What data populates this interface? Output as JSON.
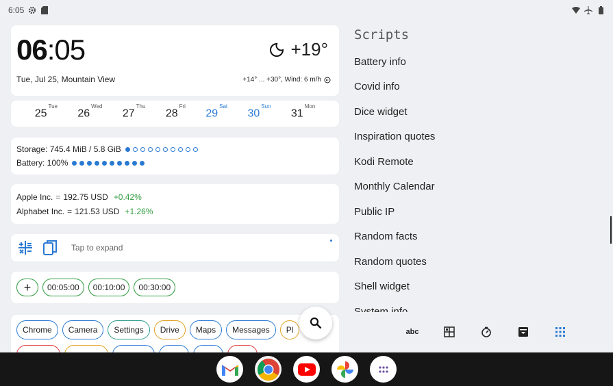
{
  "status_bar": {
    "time": "6:05"
  },
  "clock": {
    "hours": "06",
    "separator": ":",
    "minutes": "05",
    "date": "Tue, Jul 25, Mountain View"
  },
  "weather": {
    "temperature": "+19°",
    "detail": "+14° ... +30°, Wind: 6 m/h"
  },
  "calendar": {
    "days": [
      {
        "num": "25",
        "dow": "Tue"
      },
      {
        "num": "26",
        "dow": "Wed"
      },
      {
        "num": "27",
        "dow": "Thu"
      },
      {
        "num": "28",
        "dow": "Fri"
      },
      {
        "num": "29",
        "dow": "Sat"
      },
      {
        "num": "30",
        "dow": "Sun"
      },
      {
        "num": "31",
        "dow": "Mon"
      }
    ]
  },
  "system": {
    "storage_label": "Storage: 745.4 MiB / 5.8 GiB",
    "storage_fraction": 0.1,
    "battery_label": "Battery: 100%",
    "battery_fraction": 1.0
  },
  "stocks": [
    {
      "name": "Apple Inc.",
      "eq": "=",
      "price": "192.75 USD",
      "change": "+0.42%"
    },
    {
      "name": "Alphabet Inc.",
      "eq": "=",
      "price": "121.53 USD",
      "change": "+1.26%"
    }
  ],
  "notes": {
    "hint": "Tap to expand"
  },
  "timers": {
    "add": "+",
    "presets": [
      "00:05:00",
      "00:10:00",
      "00:30:00"
    ]
  },
  "apps": {
    "items": [
      {
        "label": "Chrome",
        "color": "#2a7ad3"
      },
      {
        "label": "Camera",
        "color": "#2a7ad3"
      },
      {
        "label": "Settings",
        "color": "#2a9c8c"
      },
      {
        "label": "Drive",
        "color": "#e0a020"
      },
      {
        "label": "Maps",
        "color": "#2a7ad3"
      },
      {
        "label": "Messages",
        "color": "#2a7ad3"
      },
      {
        "label": "Pl",
        "color": "#e0a020"
      }
    ],
    "second_row_colors": [
      "#e03a3a",
      "#e0a020",
      "#2a7ad3",
      "#2a7ad3",
      "#2a7ad3",
      "#e03a3a"
    ]
  },
  "scripts": {
    "title": "Scripts",
    "items": [
      "Battery info",
      "Covid info",
      "Dice widget",
      "Inspiration quotes",
      "Kodi Remote",
      "Monthly Calendar",
      "Public IP",
      "Random facts",
      "Random quotes",
      "Shell widget",
      "System info"
    ]
  },
  "toolbar": {
    "abc_label": "abc"
  },
  "colors": {
    "accent": "#2a7ad3",
    "positive": "#2e9b3e",
    "dock": "#161616"
  }
}
